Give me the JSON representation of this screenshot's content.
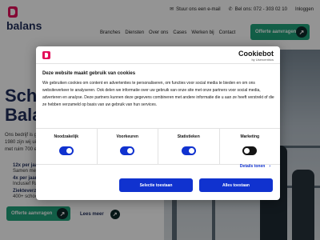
{
  "topbar": {
    "email_label": "Stuur ons een e-mail",
    "phone_label": "Bel ons: 072 - 303 02 10",
    "login_label": "Inloggen"
  },
  "brand": {
    "name": "balans",
    "accent": "#e30f5a",
    "primary": "#1f2d5a"
  },
  "nav": {
    "items": [
      "Branches",
      "Diensten",
      "Over ons",
      "Cases",
      "Werken bij",
      "Contact"
    ]
  },
  "cta_top": {
    "label": "Offerte aanvragen"
  },
  "hero": {
    "title_line1": "Schoo",
    "title_line2": "Balan",
    "body_line1": "Ons bedrijf is g",
    "body_line2": "1980 zijn wij ui",
    "body_line3": "met ruim 700 er",
    "stats": [
      {
        "title": "12x per jaar",
        "sub": "Samen met j"
      },
      {
        "title": "4x per jaar",
        "sub": "Inclusief Ray"
      },
      {
        "title": "Ziekteverzuim lager dan 5%",
        "sub": "400+ schoonmakers in dienst"
      }
    ],
    "btn_offer": "Offerte aanvragen",
    "btn_more": "Lees meer"
  },
  "cookie": {
    "brand_main": "Cookiebot",
    "brand_sub": "by Usercentrics",
    "title": "Deze website maakt gebruik van cookies",
    "text": "We gebruiken cookies om content en advertenties te personaliseren, om functies voor social media te bieden en om ons websiteverkeer te analyseren. Ook delen we informatie over uw gebruik van onze site met onze partners voor social media, adverteren en analyse. Deze partners kunnen deze gegevens combineren met andere informatie die u aan ze heeft verstrekt of die ze hebben verzameld op basis van uw gebruik van hun services.",
    "categories": [
      {
        "label": "Noodzakelijk",
        "enabled": true
      },
      {
        "label": "Voorkeuren",
        "enabled": true
      },
      {
        "label": "Statistieken",
        "enabled": true
      },
      {
        "label": "Marketing",
        "enabled": false
      }
    ],
    "details_label": "Details tonen",
    "selection_label": "Selectie toestaan",
    "allow_all_label": "Alles toestaan",
    "accent": "#1032cf"
  }
}
